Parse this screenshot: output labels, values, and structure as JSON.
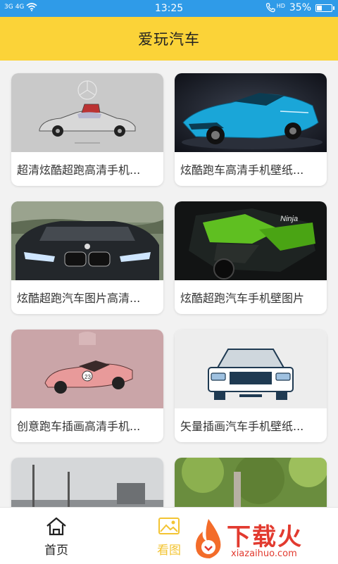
{
  "status_bar": {
    "network_left": "3G",
    "network_right": "4G",
    "time": "13:25",
    "hd_label": "HD",
    "battery": "35%",
    "battery_level": 0.35
  },
  "app_bar": {
    "title": "爱玩汽车"
  },
  "cards": [
    {
      "title": "超清炫酷超跑高清手机...",
      "image": "silver-gullwing-car"
    },
    {
      "title": "炫酷跑车高清手机壁纸...",
      "image": "blue-supercar"
    },
    {
      "title": "炫酷超跑汽车图片高清...",
      "image": "black-convertible"
    },
    {
      "title": "炫酷超跑汽车手机壁图片",
      "image": "green-motorcycle"
    },
    {
      "title": "创意跑车插画高清手机...",
      "image": "pink-racecar-illustration"
    },
    {
      "title": "矢量插画汽车手机壁纸...",
      "image": "pickup-truck-vector"
    },
    {
      "title": "",
      "image": "city-street-photo"
    },
    {
      "title": "",
      "image": "green-forest-photo"
    }
  ],
  "tabs": [
    {
      "label": "首页",
      "icon": "home-icon",
      "active": false
    },
    {
      "label": "看图",
      "icon": "gallery-icon",
      "active": true
    }
  ],
  "watermark": {
    "text": "下载火",
    "url": "xiazaihuo.com"
  },
  "colors": {
    "status": "#2f9be8",
    "appbar": "#fbd338",
    "active_tab": "#f3c433",
    "watermark": "#e23a2f"
  }
}
